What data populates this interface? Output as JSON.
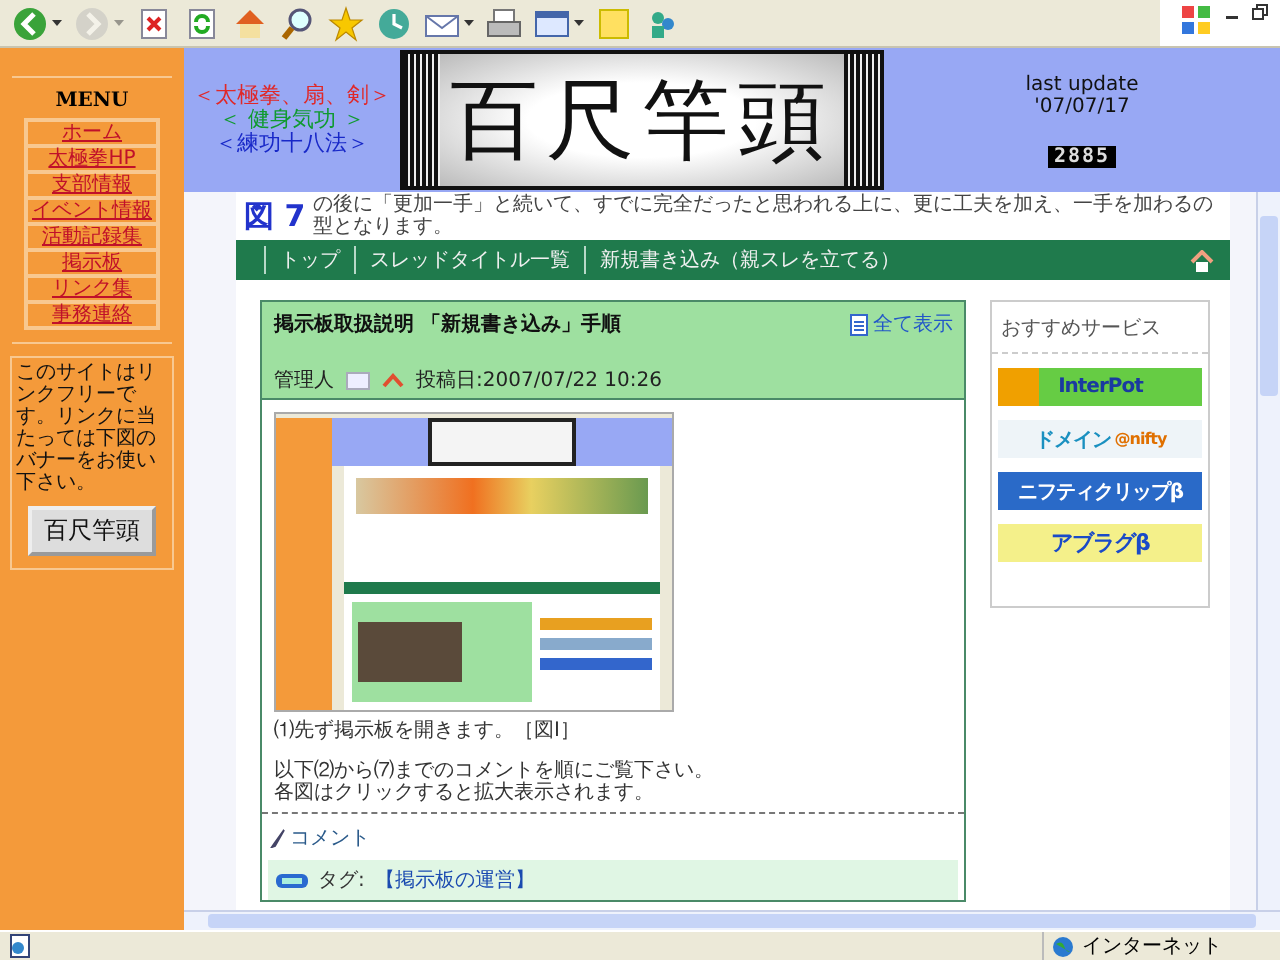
{
  "toolbar": {
    "buttons": [
      {
        "kind": "back",
        "menu": true,
        "disabled": false
      },
      {
        "kind": "forward",
        "menu": true,
        "disabled": true
      },
      {
        "kind": "stop",
        "menu": false,
        "disabled": false
      },
      {
        "kind": "refresh",
        "menu": false,
        "disabled": false
      },
      {
        "kind": "home",
        "menu": false,
        "disabled": false
      },
      {
        "kind": "search",
        "menu": false,
        "disabled": false
      },
      {
        "kind": "favorites",
        "menu": false,
        "disabled": false
      },
      {
        "kind": "history",
        "menu": false,
        "disabled": false
      },
      {
        "kind": "mail",
        "menu": true,
        "disabled": false
      },
      {
        "kind": "print",
        "menu": false,
        "disabled": false
      },
      {
        "kind": "edit",
        "menu": true,
        "disabled": false
      },
      {
        "kind": "note",
        "menu": false,
        "disabled": false
      },
      {
        "kind": "messenger",
        "menu": false,
        "disabled": false
      }
    ]
  },
  "sidebar": {
    "title": "MENU",
    "items": [
      "ホーム",
      "太極拳HP",
      "支部情報",
      "イベント情報",
      "活動記録集",
      "掲示板",
      "リンク集",
      "事務連絡"
    ],
    "notice": "このサイトはリンクフリーです。リンクに当たっては下図のバナーをお使い下さい。",
    "banner": "百尺竿頭"
  },
  "header": {
    "styles": [
      {
        "text": "＜太極拳、扇、剣＞",
        "color": "#e02828"
      },
      {
        "text": "＜ 健身気功 ＞",
        "color": "#109a30"
      },
      {
        "text": "＜練功十八法＞",
        "color": "#1828c8"
      }
    ],
    "logo": "百尺竿頭",
    "update_label": "last update",
    "update_date": "'07/07/17",
    "counter": "2885"
  },
  "content": {
    "figure_label": "図 7",
    "cut_text": "の後に「更加一手」と続いて、すでに完全だったと思われる上に、更に工夫を加え、一手を加わるの型となります。",
    "nav": {
      "items": [
        "トップ",
        "スレッドタイトル一覧",
        "新規書き込み（親スレを立てる）"
      ]
    },
    "post": {
      "title": "掲示板取扱説明 「新規書き込み」手順",
      "show_all": "全て表示",
      "author": "管理人",
      "date": "投稿日:2007/07/22 10:26",
      "lines": [
        "⑴先ず掲示板を開きます。［図Ⅰ］",
        "以下⑵から⑺までのコメントを順にご覧下さい。",
        "各図はクリックすると拡大表示されます。"
      ],
      "comment": "コメント",
      "tag_label": "タグ:",
      "tag": "【掲示板の運営】"
    },
    "services": {
      "title": "おすすめサービス",
      "banners": [
        {
          "kind": "interpot",
          "text": "InterPot"
        },
        {
          "kind": "domain",
          "text": "ドメイン",
          "sub": "@nifty"
        },
        {
          "kind": "clip",
          "text": "ニフティクリップβ"
        },
        {
          "kind": "ablog",
          "text": "アブラグβ"
        }
      ]
    }
  },
  "status_bar": {
    "zone": "インターネット"
  }
}
